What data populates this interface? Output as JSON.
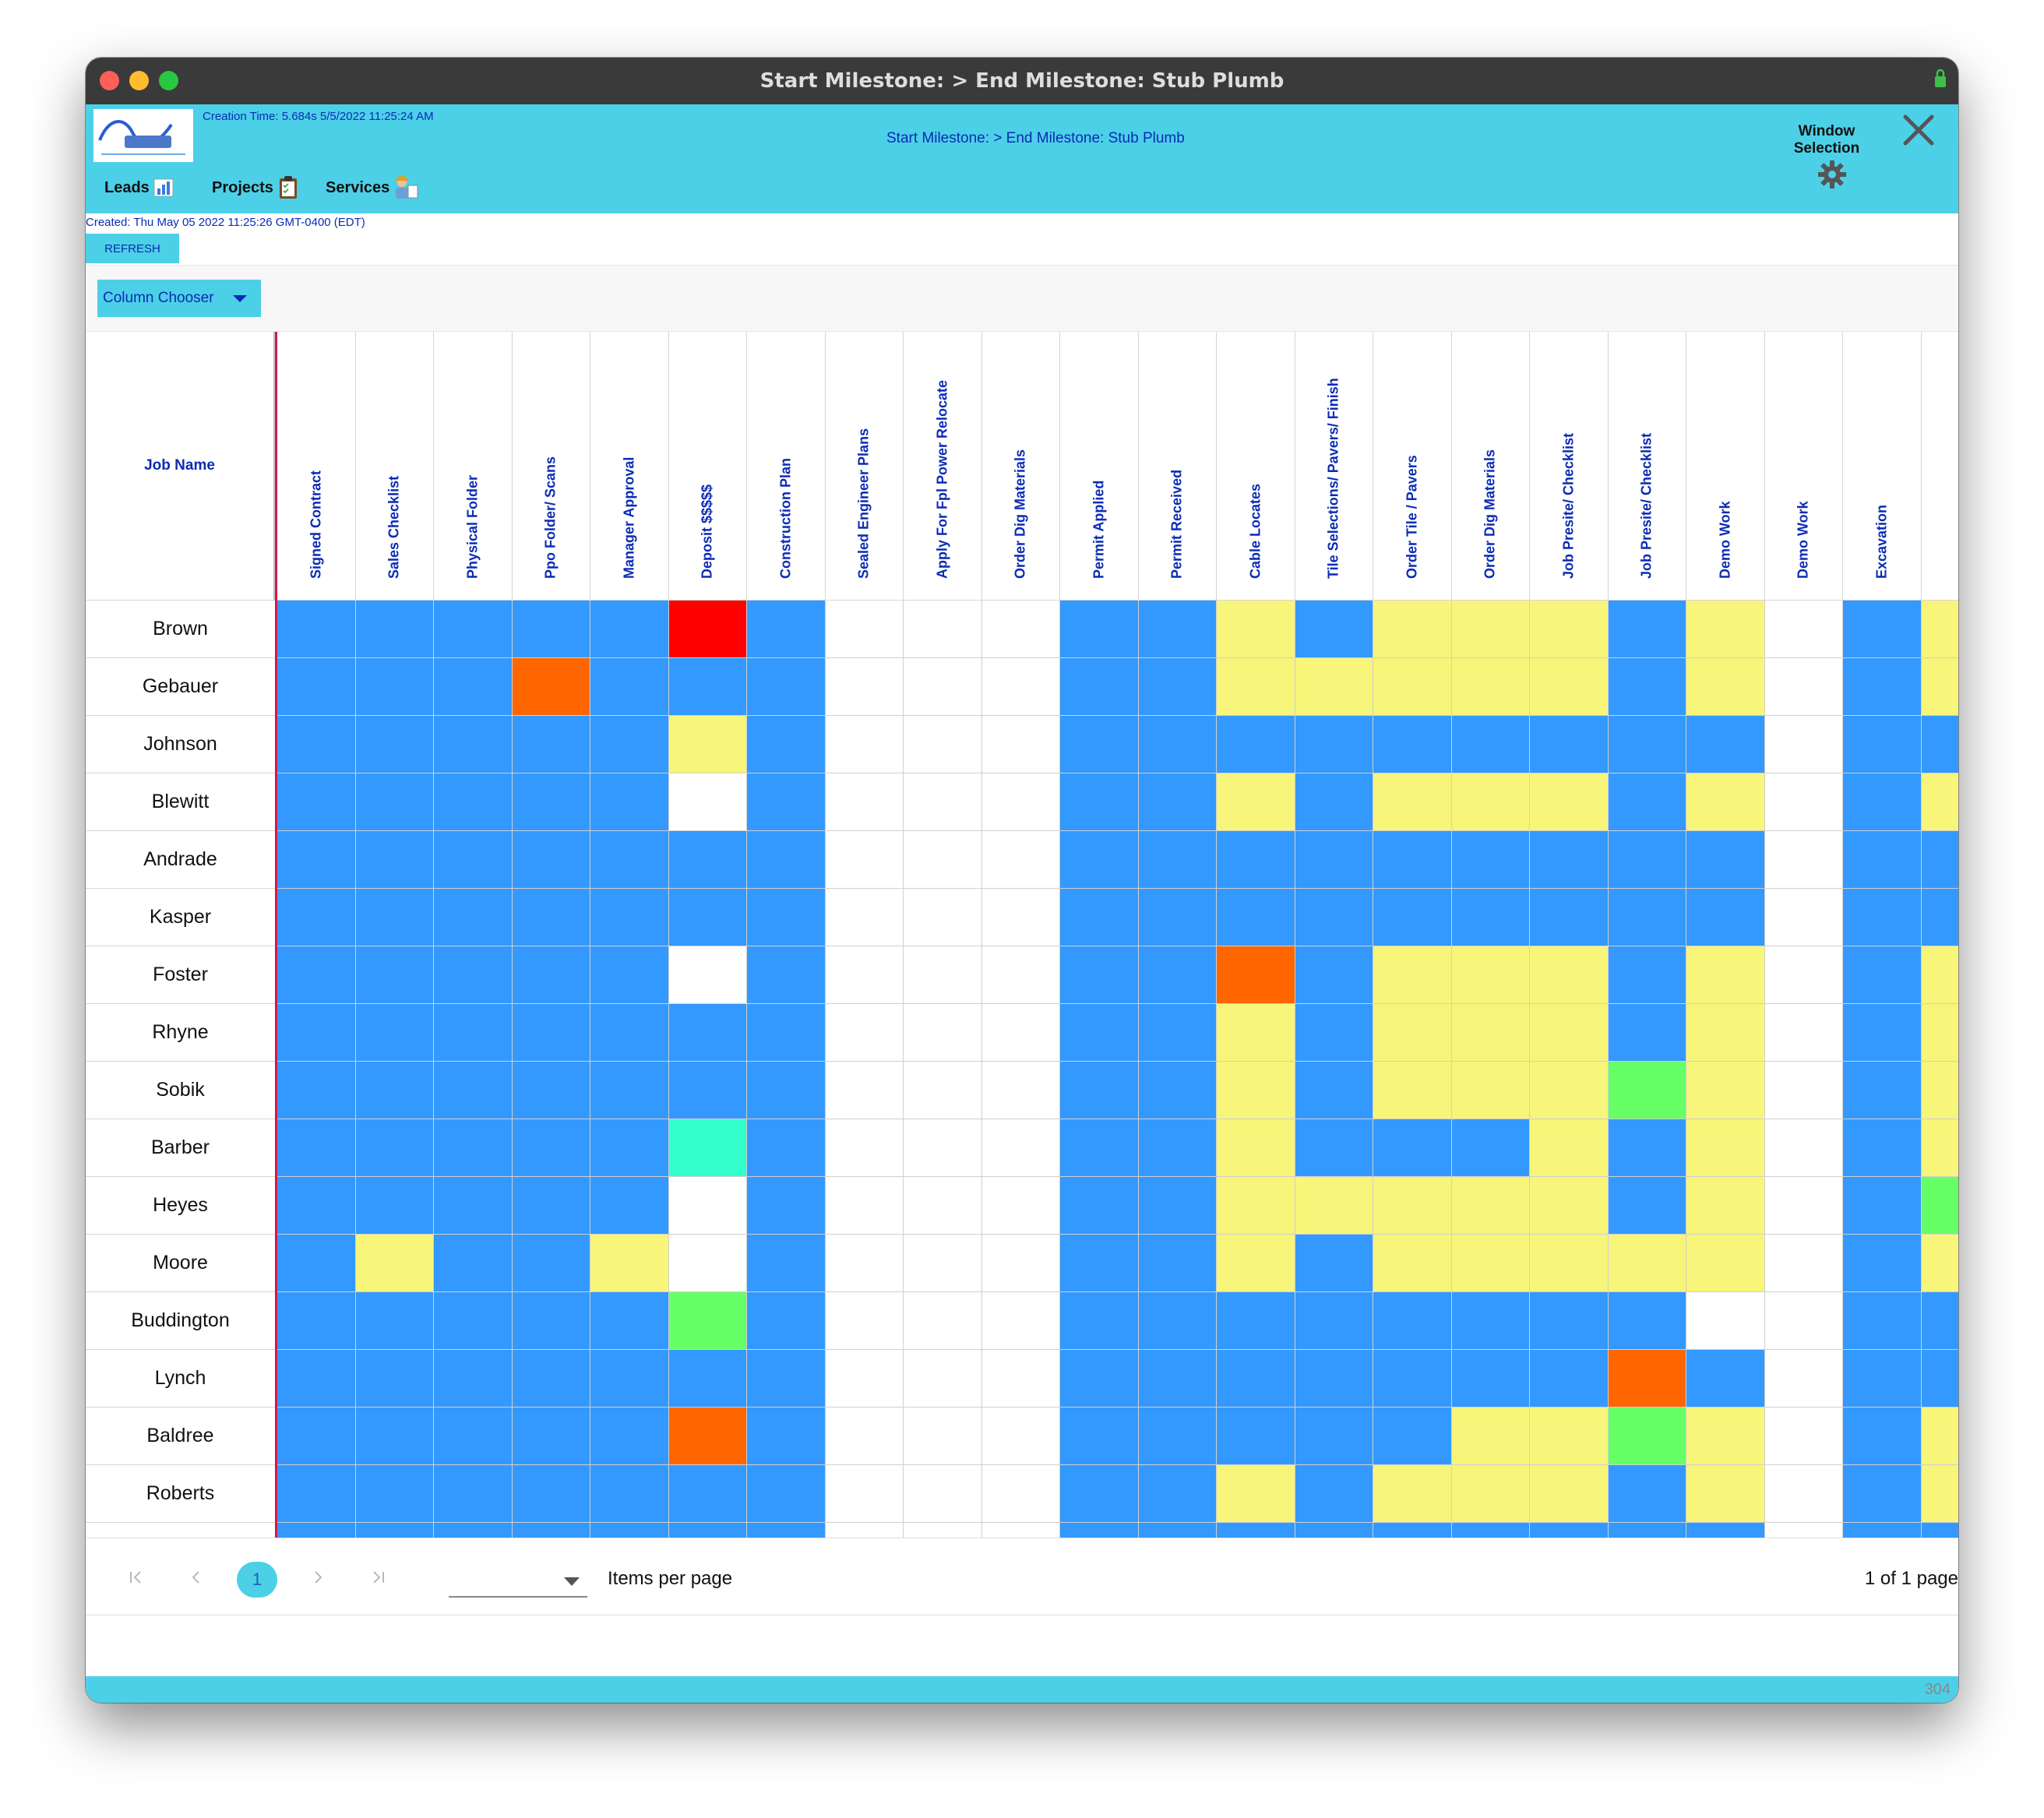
{
  "window": {
    "title": "Start Milestone:  > End Milestone: Stub Plumb"
  },
  "header": {
    "creation_time": "Creation Time: 5.684s 5/5/2022 11:25:24 AM",
    "milestone": "Start Milestone:  > End Milestone: Stub Plumb",
    "nav": [
      {
        "label": "Leads"
      },
      {
        "label": "Projects"
      },
      {
        "label": "Services"
      }
    ],
    "window_selection": [
      "Window",
      "Selection"
    ]
  },
  "created_line": "Created: Thu May 05 2022 11:25:26 GMT-0400 (EDT)",
  "refresh_label": "REFRESH",
  "column_chooser_label": "Column Chooser",
  "grid": {
    "job_header": "Job Name",
    "columns": [
      "Signed Contract",
      "Sales Checklist",
      "Physical Folder",
      "Ppo Folder/ Scans",
      "Manager Approval",
      "Deposit $$$$$",
      "Construction Plan",
      "Sealed Engineer Plans",
      "Apply For Fpl Power Relocate",
      "Order Dig Materials",
      "Permit Applied",
      "Permit Received",
      "Cable Locates",
      "Tile Selections/ Pavers/ Finish",
      "Order Tile / Pavers",
      "Order Dig Materials",
      "Job Presite/ Checklist",
      "Job Presite/ Checklist",
      "Demo Work",
      "Demo Work",
      "Excavation",
      ""
    ],
    "rows": [
      {
        "name": "Brown",
        "cells": "BBBBBRBWWWBBYBYYYBYWBY"
      },
      {
        "name": "Gebauer",
        "cells": "BBBOBBBWWWBBYYYYYBYWBY"
      },
      {
        "name": "Johnson",
        "cells": "BBBBBYBWWWBBBBBBBBBWBB"
      },
      {
        "name": "Blewitt",
        "cells": "BBBBBWBWWWBBYBYYYBYWBY"
      },
      {
        "name": "Andrade",
        "cells": "BBBBBBBWWWBBBBBBBBBWBB"
      },
      {
        "name": "Kasper",
        "cells": "BBBBBBBWWWBBBBBBBBBWBB"
      },
      {
        "name": "Foster",
        "cells": "BBBBBWBWWWBBOBYYYBYWBY"
      },
      {
        "name": "Rhyne",
        "cells": "BBBBBBBWWWBBYBYYYBYWBY"
      },
      {
        "name": "Sobik",
        "cells": "BBBBBBBWWWBBYBYYYGYWBY"
      },
      {
        "name": "Barber",
        "cells": "BBBBBTBWWWBBYBBBYBYWBY"
      },
      {
        "name": "Heyes",
        "cells": "BBBBBWBWWWBBYYYYYBYWBG"
      },
      {
        "name": "Moore",
        "cells": "BYBBYWBWWWBBYBYYYYYWBY"
      },
      {
        "name": "Buddington",
        "cells": "BBBBBGBWWWBBBBBBBBWWBB"
      },
      {
        "name": "Lynch",
        "cells": "BBBBBBBWWWBBBBBBBOBWBB"
      },
      {
        "name": "Baldree",
        "cells": "BBBBBOBWWWBBBBBYYGYWBY"
      },
      {
        "name": "Roberts",
        "cells": "BBBBBBBWWWBBYBYYYBYWBY"
      },
      {
        "name": "",
        "cells": "BBBBBBBWWWBBBBBBBBBWBB"
      }
    ]
  },
  "pager": {
    "current_page": "1",
    "items_per_page_label": "Items per page",
    "info": "1 of 1 page"
  },
  "footer_number": "304",
  "colors": {
    "header_cyan": "#4cd0e7",
    "link_blue": "#0b2bb5",
    "B": "#3399ff",
    "Y": "#f7f57a",
    "O": "#ff6600",
    "R": "#ff0000",
    "G": "#66ff66",
    "T": "#33ffcc",
    "W": "#ffffff"
  }
}
